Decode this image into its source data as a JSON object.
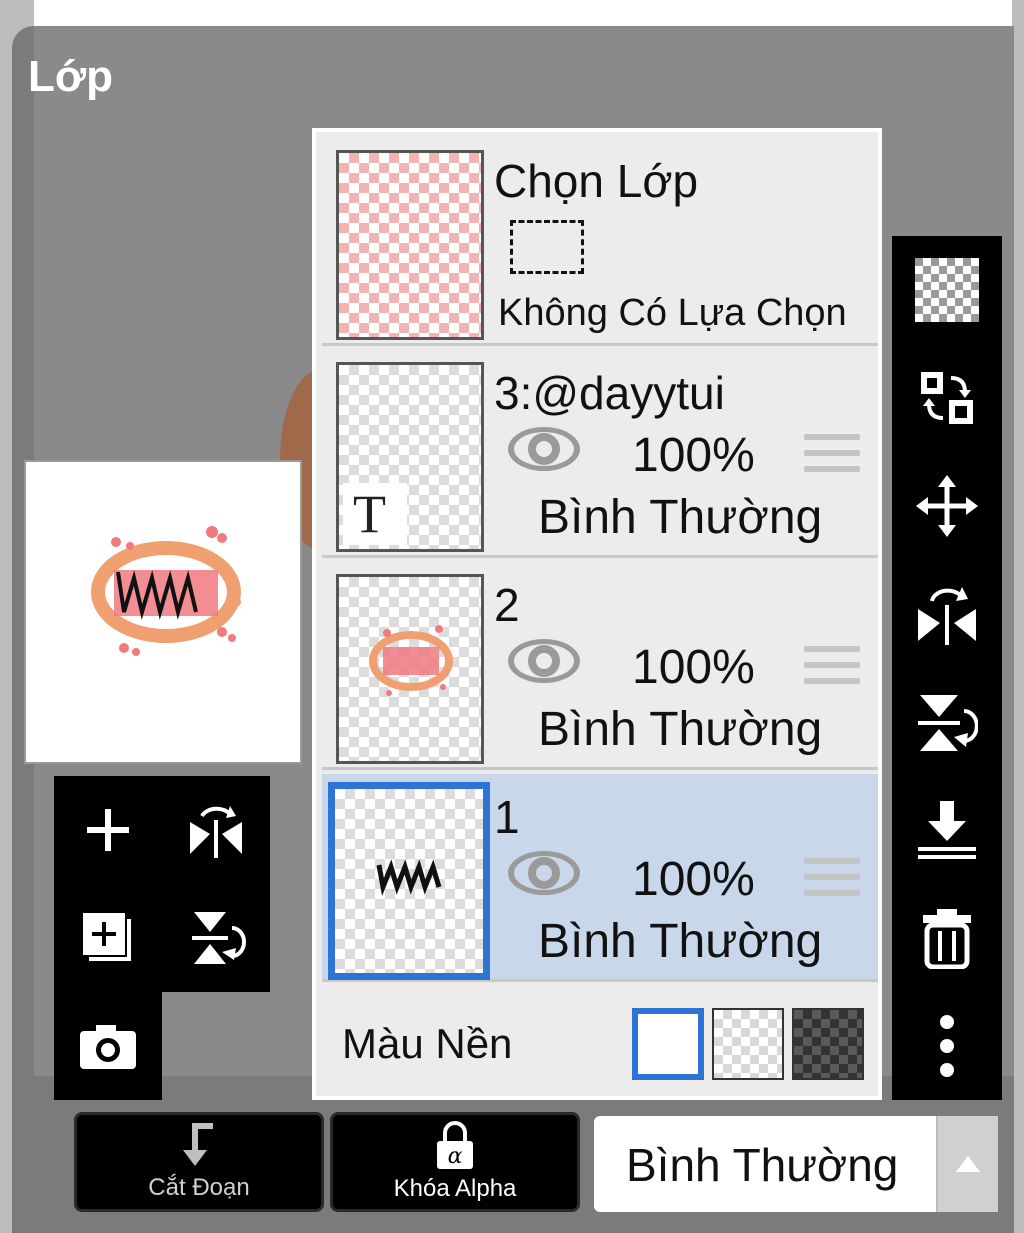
{
  "panel": {
    "title": "Lớp"
  },
  "selection_layer": {
    "title": "Chọn Lớp",
    "status": "Không Có Lựa Chọn"
  },
  "layers": [
    {
      "name": "3:@dayytui",
      "opacity": "100%",
      "blend": "Bình Thường",
      "type_badge": "T",
      "visible": true
    },
    {
      "name": "2",
      "opacity": "100%",
      "blend": "Bình Thường",
      "visible": true
    },
    {
      "name": "1",
      "opacity": "100%",
      "blend": "Bình Thường",
      "visible": true,
      "selected": true
    }
  ],
  "background": {
    "label": "Màu Nền",
    "selected": "white"
  },
  "bottom_bar": {
    "clip_label": "Cắt Đoạn",
    "alpha_lock_label": "Khóa Alpha",
    "blend_mode": "Bình Thường"
  },
  "colors": {
    "accent": "#2e74d6",
    "selected_row": "#c9d7ea",
    "toolbar": "#000000"
  }
}
